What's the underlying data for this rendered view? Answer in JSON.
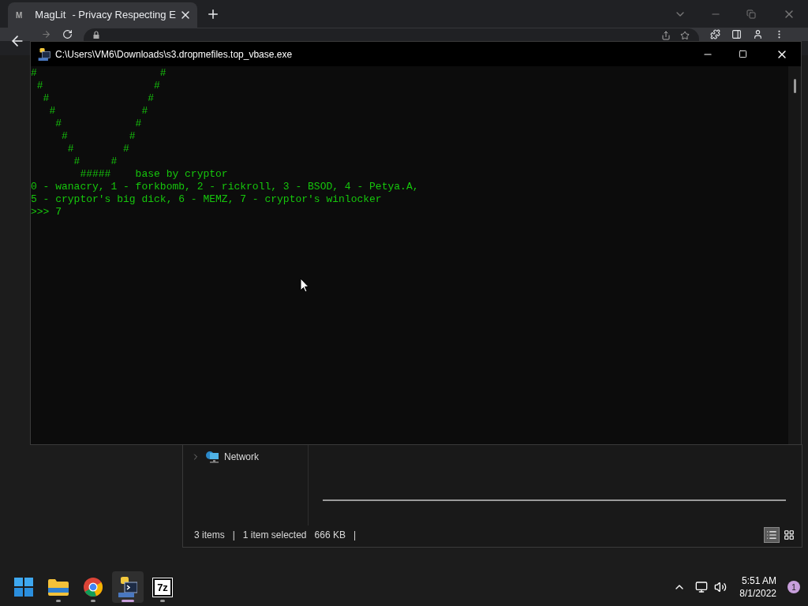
{
  "browser": {
    "tab": {
      "favicon": "M",
      "title": "MagLit",
      "title_rest": "- Privacy Respecting E",
      "selected": true
    }
  },
  "console": {
    "title": "C:\\Users\\VM6\\Downloads\\s3.dropmefiles.top_vbase.exe",
    "lines": [
      "#                    #",
      " #                  #",
      "  #                #",
      "   #              #",
      "    #            #",
      "     #          #",
      "      #        #",
      "       #     #",
      "        #####    base by cryptor",
      "0 - wanacry, 1 - forkbomb, 2 - rickroll, 3 - BSOD, 4 - Petya.A,",
      "5 - cryptor's big dick, 6 - MEMZ, 7 - cryptor's winlocker",
      ">>> 7"
    ]
  },
  "explorer": {
    "nav": [
      {
        "label": "Network",
        "expanded": false
      }
    ],
    "status": [
      "3 items",
      "|",
      "1 item selected",
      "666 KB",
      "|"
    ],
    "views": [
      {
        "kind": "details",
        "selected": true
      },
      {
        "kind": "tiles",
        "selected": false
      }
    ]
  },
  "taskbar": {
    "apps": [
      {
        "kind": "start",
        "running": false,
        "selected": false
      },
      {
        "kind": "folder",
        "running": true,
        "selected": false
      },
      {
        "kind": "chrome",
        "running": true,
        "selected": false
      },
      {
        "kind": "console",
        "running": true,
        "selected": true
      },
      {
        "kind": "archiver",
        "label": "7z",
        "running": true,
        "selected": false
      }
    ],
    "clock": {
      "time": "5:51 AM",
      "date": "8/1/2022"
    },
    "notifications": "1"
  }
}
